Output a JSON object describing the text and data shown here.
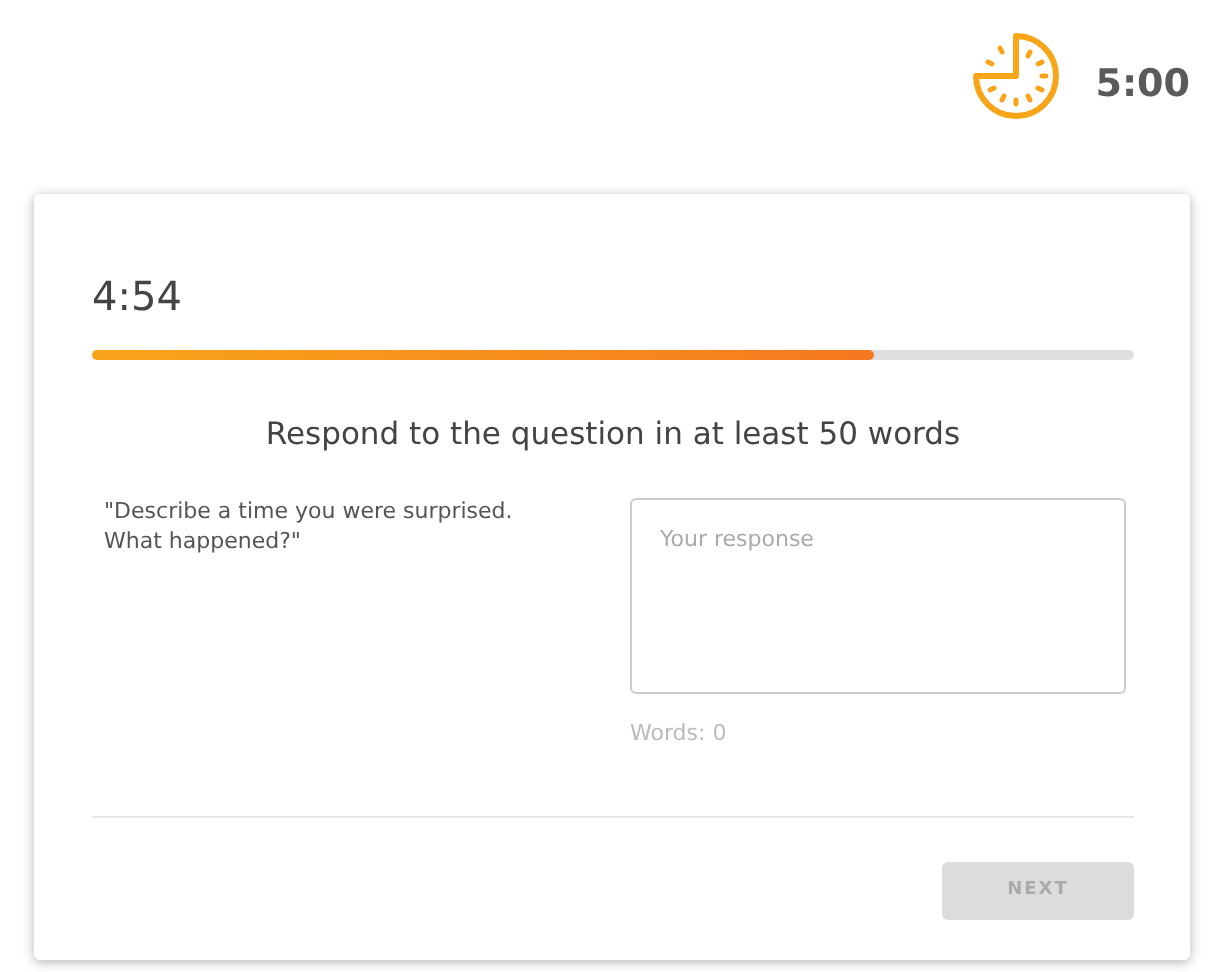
{
  "timer": {
    "total": "5:00"
  },
  "card": {
    "remaining": "4:54",
    "progress": {
      "level": 0.75
    },
    "instruction": "Respond to the question in at least 50 words",
    "question": "\"Describe a time you were surprised. What happened?\"",
    "response": {
      "placeholder": "Your response"
    },
    "word_count": "Words: 0",
    "next_button": {
      "label": "NEXT",
      "disabled": true
    }
  }
}
